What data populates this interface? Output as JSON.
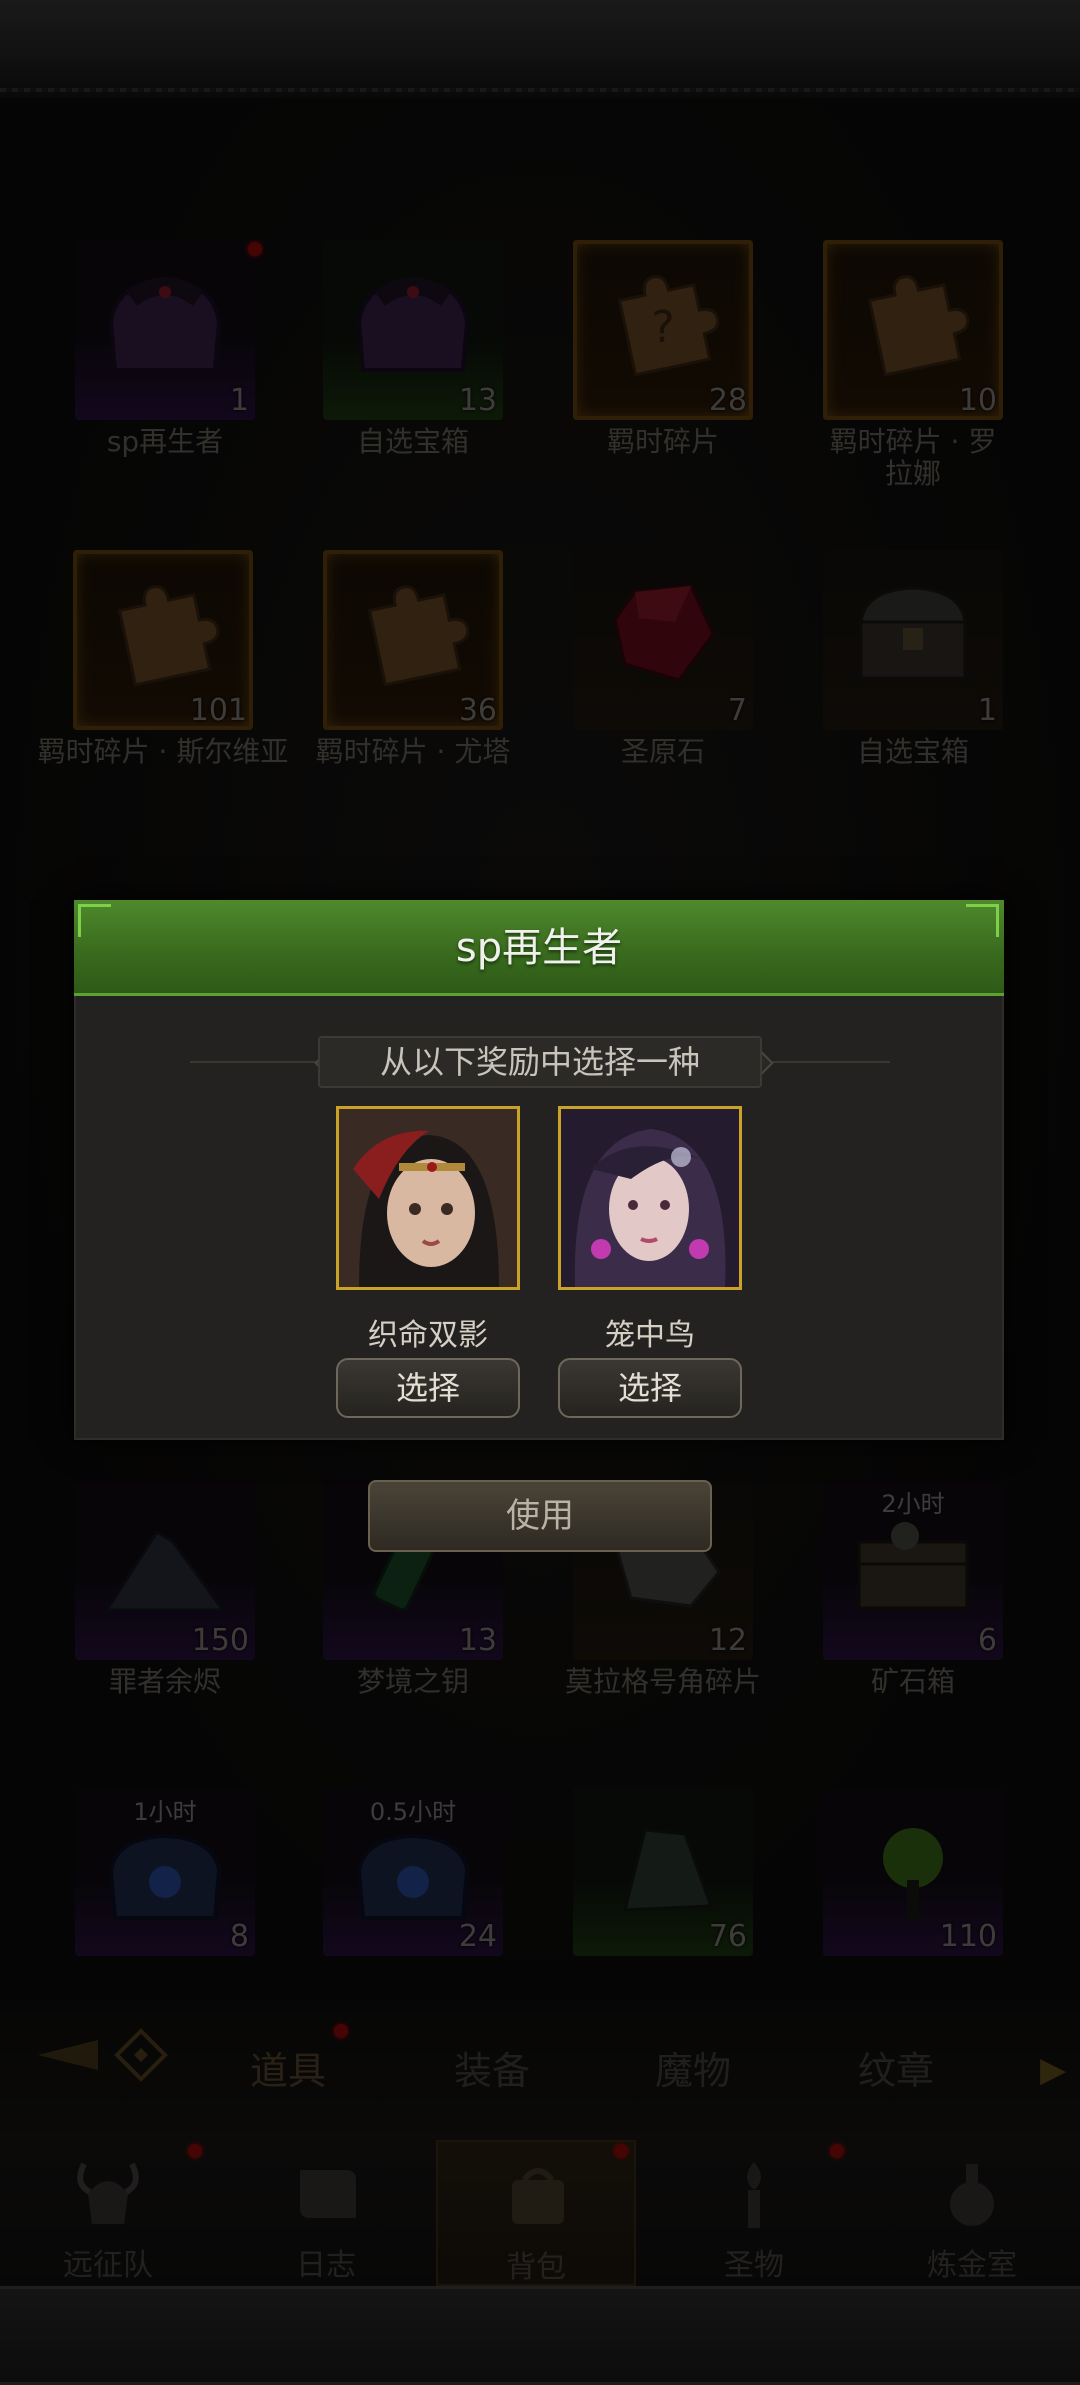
{
  "items_row1": [
    {
      "name": "sp再生者",
      "count": "1",
      "rarity": "purple",
      "icon": "purple-chest-icon",
      "badge": true
    },
    {
      "name": "自选宝箱",
      "count": "13",
      "rarity": "green",
      "icon": "purple-chest-icon"
    },
    {
      "name": "羁时碎片",
      "count": "28",
      "rarity": "orange",
      "icon": "puzzle-question-icon"
    },
    {
      "name": "羁时碎片 · 罗拉娜",
      "count": "10",
      "rarity": "orange",
      "icon": "puzzle-piece-icon"
    }
  ],
  "items_row2": [
    {
      "name": "羁时碎片 · 斯尔维亚",
      "count": "101",
      "rarity": "orange",
      "icon": "puzzle-piece-icon"
    },
    {
      "name": "羁时碎片 · 尤塔",
      "count": "36",
      "rarity": "orange",
      "icon": "puzzle-piece-icon"
    },
    {
      "name": "圣原石",
      "count": "7",
      "rarity": "dim",
      "icon": "red-crystal-icon"
    },
    {
      "name": "自选宝箱",
      "count": "1",
      "rarity": "dim",
      "icon": "iron-chest-icon"
    }
  ],
  "items_row3": [
    {
      "name": "罪者余烬",
      "count": "150",
      "rarity": "purple",
      "icon": "ash-pile-icon"
    },
    {
      "name": "梦境之钥",
      "count": "13",
      "rarity": "purple",
      "icon": "green-key-icon"
    },
    {
      "name": "莫拉格号角碎片",
      "count": "12",
      "rarity": "dim",
      "icon": "horn-shard-icon"
    },
    {
      "name": "矿石箱",
      "count": "6",
      "rarity": "purple",
      "icon": "ore-crate-icon",
      "timer": "2小时"
    }
  ],
  "items_row4": [
    {
      "name": "",
      "count": "8",
      "rarity": "purple",
      "icon": "blue-chest-icon",
      "timer": "1小时"
    },
    {
      "name": "",
      "count": "24",
      "rarity": "purple",
      "icon": "blue-chest-icon",
      "timer": "0.5小时"
    },
    {
      "name": "",
      "count": "76",
      "rarity": "green",
      "icon": "green-stone-icon"
    },
    {
      "name": "",
      "count": "110",
      "rarity": "purple",
      "icon": "green-orb-icon"
    }
  ],
  "modal": {
    "title": "sp再生者",
    "subtitle": "从以下奖励中选择一种",
    "options": [
      {
        "name": "织命双影",
        "button": "选择",
        "icon": "hero-portrait-red-hair"
      },
      {
        "name": "笼中鸟",
        "button": "选择",
        "icon": "hero-portrait-purple-hair"
      }
    ]
  },
  "use_button": "使用",
  "tabs": [
    {
      "label": "道具",
      "active": true,
      "badge": true
    },
    {
      "label": "装备"
    },
    {
      "label": "魔物"
    },
    {
      "label": "纹章"
    }
  ],
  "nav": [
    {
      "label": "远征队",
      "icon": "horned-helmet-icon",
      "badge": true
    },
    {
      "label": "日志",
      "icon": "scroll-icon"
    },
    {
      "label": "背包",
      "icon": "backpack-icon",
      "active": true,
      "badge": true
    },
    {
      "label": "圣物",
      "icon": "torch-icon",
      "badge": true
    },
    {
      "label": "炼金室",
      "icon": "alchemy-icon"
    }
  ],
  "colors": {
    "modal_header": "#4e8a2c",
    "portrait_border": "#c9a227",
    "rarity_orange": "#6a4511",
    "rarity_purple": "#2a1240",
    "rarity_green": "#1e3a12"
  }
}
